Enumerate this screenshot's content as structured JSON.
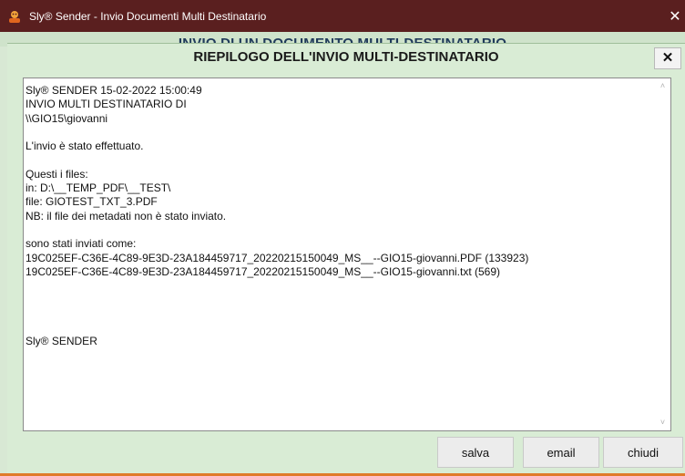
{
  "window": {
    "title": "Sly® Sender - Invio Documenti Multi Destinatario",
    "close_glyph": "✕",
    "background_header": "INVIO DI UN DOCUMENTO MULTI-DESTINATARIO"
  },
  "dialog": {
    "title": "RIEPILOGO DELL'INVIO MULTI-DESTINATARIO",
    "close_glyph": "✕",
    "report_lines": [
      "Sly® SENDER 15-02-2022 15:00:49",
      "INVIO MULTI DESTINATARIO DI",
      "\\\\GIO15\\giovanni",
      "",
      "L'invio è stato effettuato.",
      "",
      "Questi i files:",
      "in: D:\\__TEMP_PDF\\__TEST\\",
      "file: GIOTEST_TXT_3.PDF",
      "NB: il file dei metadati non è stato inviato.",
      "",
      "sono stati inviati come:",
      "19C025EF-C36E-4C89-9E3D-23A184459717_20220215150049_MS__--GIO15-giovanni.PDF (133923)",
      "19C025EF-C36E-4C89-9E3D-23A184459717_20220215150049_MS__--GIO15-giovanni.txt (569)",
      "",
      "",
      "",
      "",
      "Sly® SENDER"
    ],
    "buttons": {
      "salva": "salva",
      "email": "email",
      "chiudi": "chiudi"
    }
  },
  "icons": {
    "app": "sly-sender-app-icon",
    "scroll_up": "chevron-up-icon",
    "scroll_down": "chevron-down-icon"
  },
  "colors": {
    "titlebar": "#5a1f1f",
    "dialog_background": "#d9ecd5",
    "accent_bottom": "#e07a2a"
  }
}
